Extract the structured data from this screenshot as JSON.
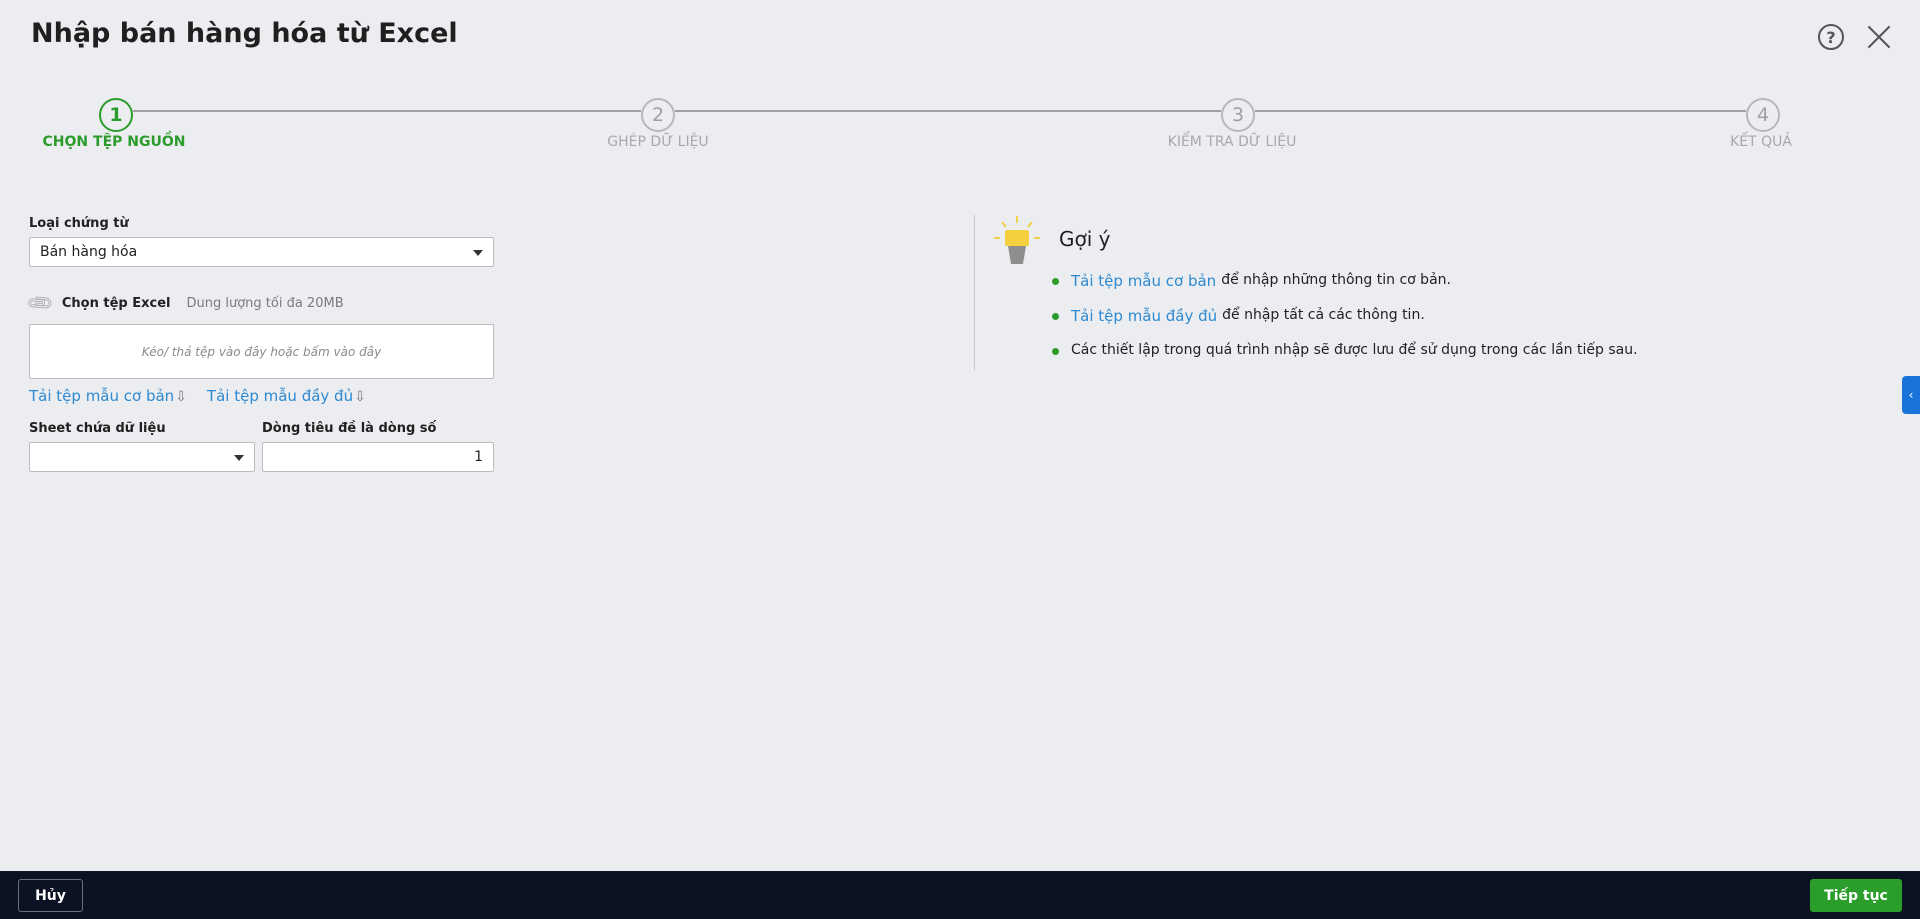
{
  "dialog": {
    "title": "Nhập bán hàng hóa từ Excel"
  },
  "steps": [
    {
      "number": "1",
      "label": "CHỌN TỆP NGUỒN",
      "active": true
    },
    {
      "number": "2",
      "label": "GHÉP DỮ LIỆU",
      "active": false
    },
    {
      "number": "3",
      "label": "KIỂM TRA DỮ LIỆU",
      "active": false
    },
    {
      "number": "4",
      "label": "KẾT QUẢ",
      "active": false
    }
  ],
  "form": {
    "doc_type_label": "Loại chứng từ",
    "doc_type_value": "Bán hàng hóa",
    "file_label": "Chọn tệp Excel",
    "file_size_hint": "Dung lượng tối đa 20MB",
    "dropzone_text": "Kéo/ thả tệp vào đây hoặc bấm vào đây",
    "link_basic": "Tải tệp mẫu cơ bản",
    "link_full": "Tải tệp mẫu đầy đủ",
    "sheet_label": "Sheet chứa dữ liệu",
    "sheet_value": "",
    "header_row_label": "Dòng tiêu đề là dòng số",
    "header_row_value": "1"
  },
  "hint": {
    "title": "Gợi ý",
    "items": [
      {
        "link": "Tải tệp mẫu cơ bản",
        "text": "để nhập những thông tin cơ bản."
      },
      {
        "link": "Tải tệp mẫu đầy đủ",
        "text": "để nhập tất cả các thông tin."
      },
      {
        "link": "",
        "text": "Các thiết lập trong quá trình nhập sẽ được lưu để sử dụng trong các lần tiếp sau."
      }
    ]
  },
  "footer": {
    "cancel_label": "Hủy",
    "next_label": "Tiếp tục"
  },
  "colors": {
    "accent_green": "#2b9c2b",
    "link_blue": "#2d8ad0",
    "footer_bg": "#0b1221",
    "side_tab_blue": "#1a73d9"
  },
  "icons": {
    "help": "help-circle-icon",
    "close": "close-icon",
    "paperclip": "paperclip-icon",
    "download": "download-arrow-icon",
    "bulb": "lightbulb-icon",
    "collapse": "chevron-left-icon"
  }
}
